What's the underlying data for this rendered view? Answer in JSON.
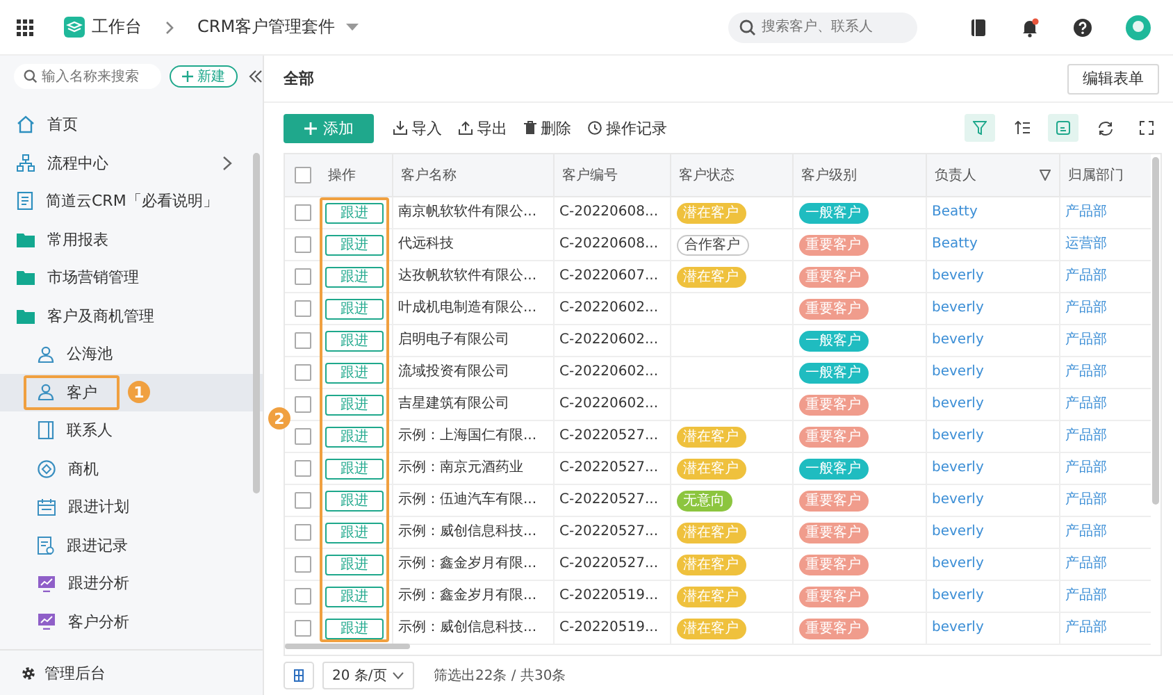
{
  "topbar": {
    "app_name": "工作台",
    "suite": "CRM客户管理套件",
    "search": {
      "placeholder": "搜索客户、联系人"
    },
    "has_notification": true
  },
  "sidebar": {
    "search": {
      "placeholder": "输入名称来搜索"
    },
    "new_button": "新建",
    "items": [
      {
        "label": "首页",
        "kind": "home",
        "selected": false
      },
      {
        "label": "流程中心",
        "kind": "group",
        "selected": false
      },
      {
        "label": "简道云CRM「必看说明」",
        "kind": "doc",
        "selected": false
      },
      {
        "label": "常用报表",
        "kind": "folder",
        "selected": false
      },
      {
        "label": "市场营销管理",
        "kind": "folder",
        "selected": false
      },
      {
        "label": "客户及商机管理",
        "kind": "folder",
        "selected": false,
        "children": [
          {
            "label": "公海池",
            "kind": "person",
            "selected": false
          },
          {
            "label": "客户",
            "kind": "person",
            "selected": true
          },
          {
            "label": "联系人",
            "kind": "contact",
            "selected": false
          },
          {
            "label": "商机",
            "kind": "deal",
            "selected": false
          },
          {
            "label": "跟进计划",
            "kind": "calendar",
            "selected": false
          },
          {
            "label": "跟进记录",
            "kind": "record",
            "selected": false
          },
          {
            "label": "跟进分析",
            "kind": "chart",
            "selected": false
          },
          {
            "label": "客户分析",
            "kind": "chart",
            "selected": false
          }
        ]
      }
    ],
    "footer": "管理后台"
  },
  "view": {
    "title": "全部",
    "edit_button": "编辑表单"
  },
  "toolbar": {
    "add_button": "添加",
    "actions": [
      {
        "label": "导入",
        "kind": "import"
      },
      {
        "label": "导出",
        "kind": "export"
      },
      {
        "label": "删除",
        "kind": "delete"
      },
      {
        "label": "操作记录",
        "kind": "history"
      }
    ],
    "tools": [
      {
        "kind": "filter",
        "active": true
      },
      {
        "kind": "sort",
        "active": false
      },
      {
        "kind": "card",
        "active": true
      },
      {
        "kind": "refresh",
        "active": false
      },
      {
        "kind": "fullscreen",
        "active": false
      }
    ]
  },
  "table": {
    "header_checked": false,
    "columns": [
      "操作",
      "客户名称",
      "客户编号",
      "客户状态",
      "客户级别",
      "负责人",
      "归属部门"
    ],
    "row_actions": [
      "跟进",
      "跟进",
      "跟进",
      "跟进",
      "跟进",
      "跟进",
      "跟进",
      "跟进",
      "跟进",
      "跟进",
      "跟进",
      "跟进",
      "跟进",
      "跟进"
    ],
    "rows": [
      {
        "checked": false,
        "name": "南京帆软软件有限公...",
        "code": "C-20220608...",
        "status": {
          "text": "潜在客户",
          "kind": "filled",
          "color": "#efc13d"
        },
        "level": {
          "text": "一般客户",
          "color": "#1fbcc0"
        },
        "owner": "Beatty",
        "dept": "产品部"
      },
      {
        "checked": false,
        "name": "代远科技",
        "code": "C-20220608...",
        "status": {
          "text": "合作客户",
          "kind": "outline",
          "color": "#c8c8c8"
        },
        "level": {
          "text": "重要客户",
          "color": "#f09c8c"
        },
        "owner": "Beatty",
        "dept": "运营部"
      },
      {
        "checked": false,
        "name": "达孜帆软软件有限公...",
        "code": "C-20220607...",
        "status": {
          "text": "潜在客户",
          "kind": "filled",
          "color": "#efc13d"
        },
        "level": {
          "text": "重要客户",
          "color": "#f09c8c"
        },
        "owner": "beverly",
        "dept": "产品部"
      },
      {
        "checked": false,
        "name": "叶成机电制造有限公...",
        "code": "C-20220602...",
        "level": {
          "text": "重要客户",
          "color": "#f09c8c"
        },
        "owner": "beverly",
        "dept": "产品部"
      },
      {
        "checked": false,
        "name": "启明电子有限公司",
        "code": "C-20220602...",
        "level": {
          "text": "一般客户",
          "color": "#1fbcc0"
        },
        "owner": "beverly",
        "dept": "产品部"
      },
      {
        "checked": false,
        "name": "流域投资有限公司",
        "code": "C-20220602...",
        "level": {
          "text": "一般客户",
          "color": "#1fbcc0"
        },
        "owner": "beverly",
        "dept": "产品部"
      },
      {
        "checked": false,
        "name": "吉星建筑有限公司",
        "code": "C-20220602...",
        "level": {
          "text": "重要客户",
          "color": "#f09c8c"
        },
        "owner": "beverly",
        "dept": "产品部"
      },
      {
        "checked": false,
        "name": "示例：上海国仁有限...",
        "code": "C-20220527...",
        "status": {
          "text": "潜在客户",
          "kind": "filled",
          "color": "#efc13d"
        },
        "level": {
          "text": "重要客户",
          "color": "#f09c8c"
        },
        "owner": "beverly",
        "dept": "产品部"
      },
      {
        "checked": false,
        "name": "示例：南京元酒药业",
        "code": "C-20220527...",
        "status": {
          "text": "潜在客户",
          "kind": "filled",
          "color": "#efc13d"
        },
        "level": {
          "text": "一般客户",
          "color": "#1fbcc0"
        },
        "owner": "beverly",
        "dept": "产品部"
      },
      {
        "checked": false,
        "name": "示例：伍迪汽车有限...",
        "code": "C-20220527...",
        "status": {
          "text": "无意向",
          "kind": "filled",
          "color": "#8cc53f"
        },
        "level": {
          "text": "重要客户",
          "color": "#f09c8c"
        },
        "owner": "beverly",
        "dept": "产品部"
      },
      {
        "checked": false,
        "name": "示例：威创信息科技...",
        "code": "C-20220527...",
        "status": {
          "text": "潜在客户",
          "kind": "filled",
          "color": "#efc13d"
        },
        "level": {
          "text": "重要客户",
          "color": "#f09c8c"
        },
        "owner": "beverly",
        "dept": "产品部"
      },
      {
        "checked": false,
        "name": "示例：鑫金岁月有限...",
        "code": "C-20220527...",
        "status": {
          "text": "潜在客户",
          "kind": "filled",
          "color": "#efc13d"
        },
        "level": {
          "text": "重要客户",
          "color": "#f09c8c"
        },
        "owner": "beverly",
        "dept": "产品部"
      },
      {
        "checked": false,
        "name": "示例：鑫金岁月有限...",
        "code": "C-20220519...",
        "status": {
          "text": "潜在客户",
          "kind": "filled",
          "color": "#efc13d"
        },
        "level": {
          "text": "重要客户",
          "color": "#f09c8c"
        },
        "owner": "beverly",
        "dept": "产品部"
      },
      {
        "checked": false,
        "name": "示例：威创信息科技...",
        "code": "C-20220519...",
        "status": {
          "text": "潜在客户",
          "kind": "filled",
          "color": "#efc13d"
        },
        "level": {
          "text": "重要客户",
          "color": "#f09c8c"
        },
        "owner": "beverly",
        "dept": "产品部"
      }
    ]
  },
  "footer": {
    "page_size": "20 条/页",
    "summary": "筛选出22条 / 共30条"
  },
  "annotations": {
    "sidebar_badge": "1",
    "table_badge": "2"
  }
}
